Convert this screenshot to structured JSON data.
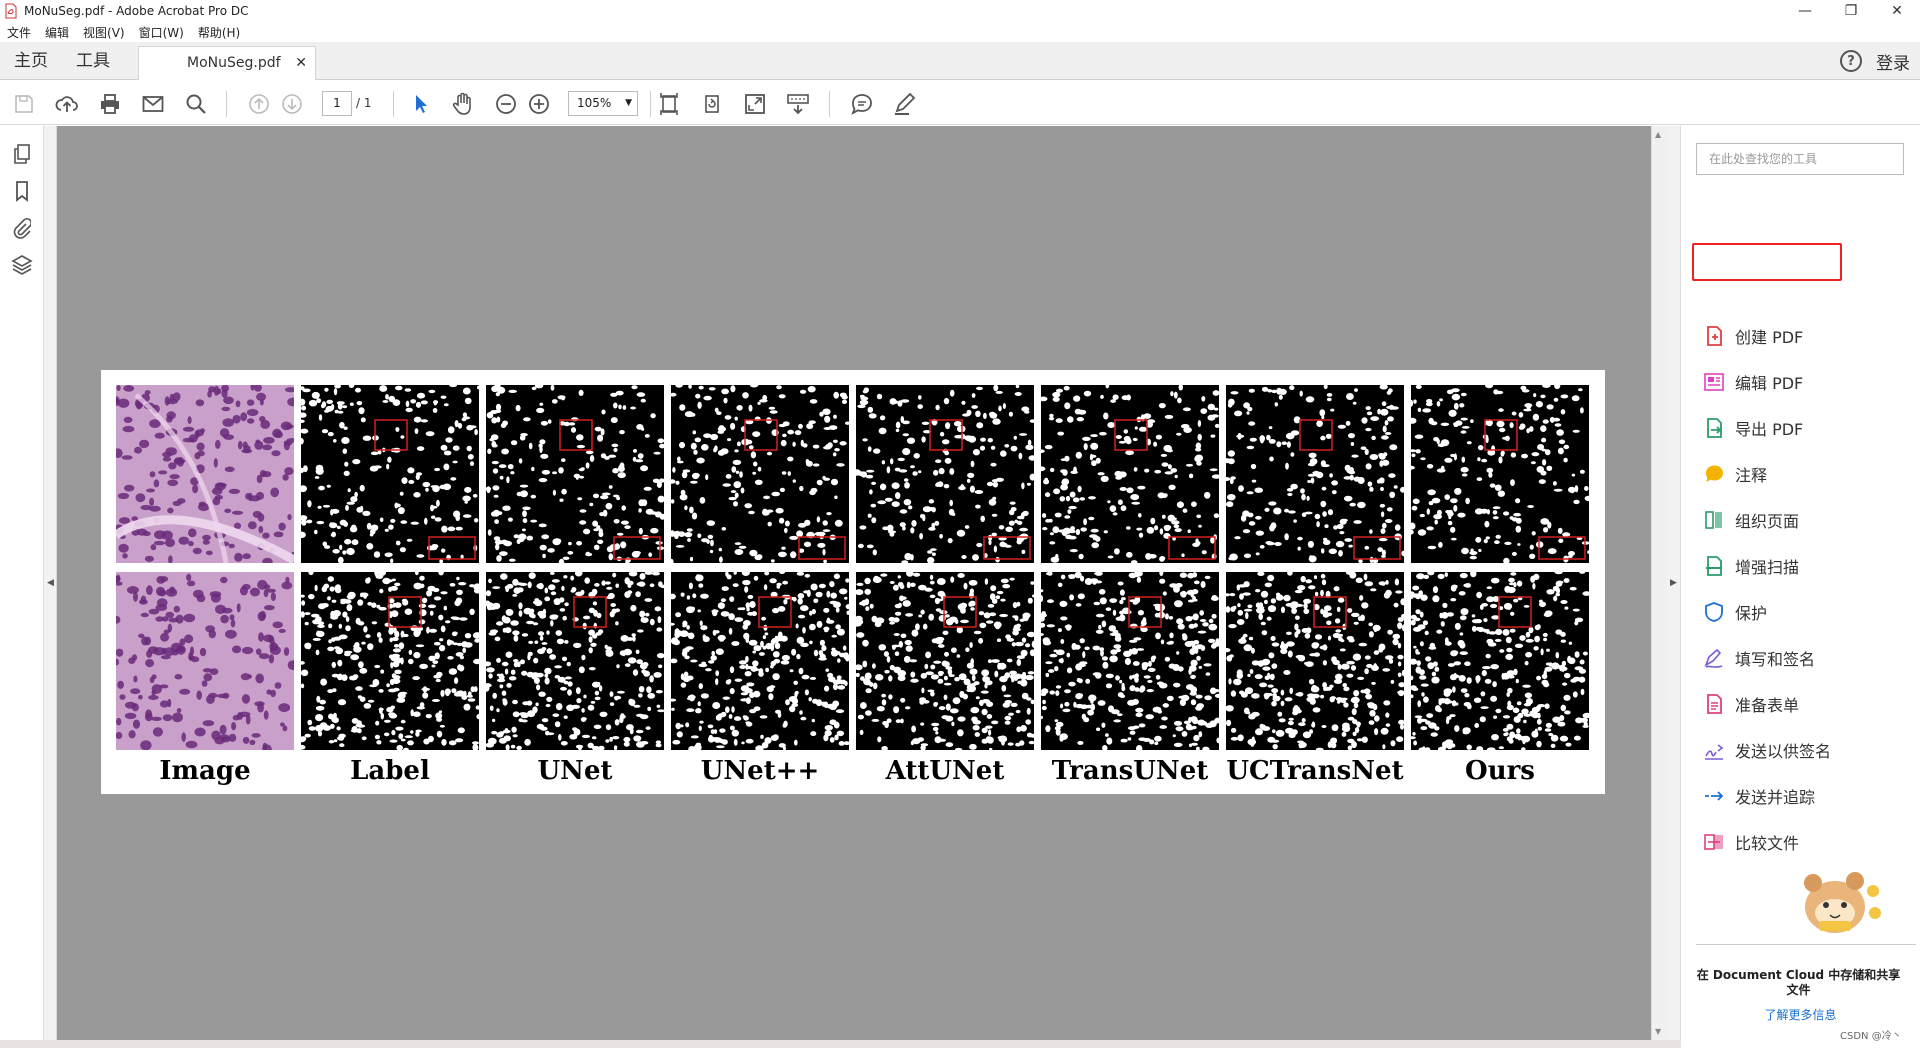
{
  "window": {
    "title": "MoNuSeg.pdf - Adobe Acrobat Pro DC",
    "controls": {
      "minimize": "—",
      "restore": "❐",
      "close": "✕"
    }
  },
  "menu": {
    "items": [
      "文件",
      "编辑",
      "视图(V)",
      "窗口(W)",
      "帮助(H)"
    ]
  },
  "nav_tabs": {
    "home": "主页",
    "tools": "工具",
    "doc_tab": "MoNuSeg.pdf",
    "doc_tab_close": "✕",
    "help": "?",
    "login": "登录"
  },
  "toolbar": {
    "page_current": "1",
    "page_total": "/ 1",
    "zoom": "105%",
    "icons": [
      "save-icon",
      "upload-icon",
      "print-icon",
      "email-icon",
      "search-icon",
      "prev-page-icon",
      "next-page-icon",
      "select-cursor-icon",
      "hand-icon",
      "zoom-out-icon",
      "zoom-in-icon",
      "fit-page-icon",
      "rotate-icon",
      "fullscreen-icon",
      "scroll-mode-icon",
      "comment-icon",
      "highlight-pen-icon"
    ]
  },
  "left_rail": {
    "icons": [
      "pages-icon",
      "bookmark-icon",
      "attachment-icon",
      "layers-icon"
    ]
  },
  "figure": {
    "captions": [
      "Image",
      "Label",
      "UNet",
      "UNet++",
      "AttUNet",
      "TransUNet",
      "UCTransNet",
      "Ours"
    ],
    "rows": 2,
    "columns": 8,
    "highlight_color": "#d42020",
    "tissue_colors": [
      "#c9a0c9",
      "#6a2a7a",
      "#f0d8ef"
    ]
  },
  "right_panel": {
    "search_placeholder": "在此处查找您的工具",
    "tools": [
      {
        "label": "创建 PDF",
        "icon": "create-pdf-icon",
        "color": "#e04040"
      },
      {
        "label": "编辑 PDF",
        "icon": "edit-pdf-icon",
        "color": "#e040c0"
      },
      {
        "label": "导出 PDF",
        "icon": "export-pdf-icon",
        "color": "#2a9d6a"
      },
      {
        "label": "注释",
        "icon": "comment-icon",
        "color": "#f2b400"
      },
      {
        "label": "组织页面",
        "icon": "organize-pages-icon",
        "color": "#2a9d6a"
      },
      {
        "label": "增强扫描",
        "icon": "enhance-scan-icon",
        "color": "#2a9d6a"
      },
      {
        "label": "保护",
        "icon": "protect-shield-icon",
        "color": "#1f6fd1"
      },
      {
        "label": "填写和签名",
        "icon": "fill-sign-icon",
        "color": "#7b5bd6"
      },
      {
        "label": "准备表单",
        "icon": "prepare-form-icon",
        "color": "#e04080"
      },
      {
        "label": "发送以供签名",
        "icon": "send-sign-icon",
        "color": "#7b5bd6"
      },
      {
        "label": "发送并追踪",
        "icon": "send-track-icon",
        "color": "#1f6fd1"
      },
      {
        "label": "比较文件",
        "icon": "compare-files-icon",
        "color": "#e04080"
      }
    ],
    "highlighted_tool": "编辑 PDF",
    "cloud_text": "在 Document Cloud 中存储和共享文件",
    "cloud_link": "了解更多信息"
  },
  "watermark": "CSDN @冷丶"
}
